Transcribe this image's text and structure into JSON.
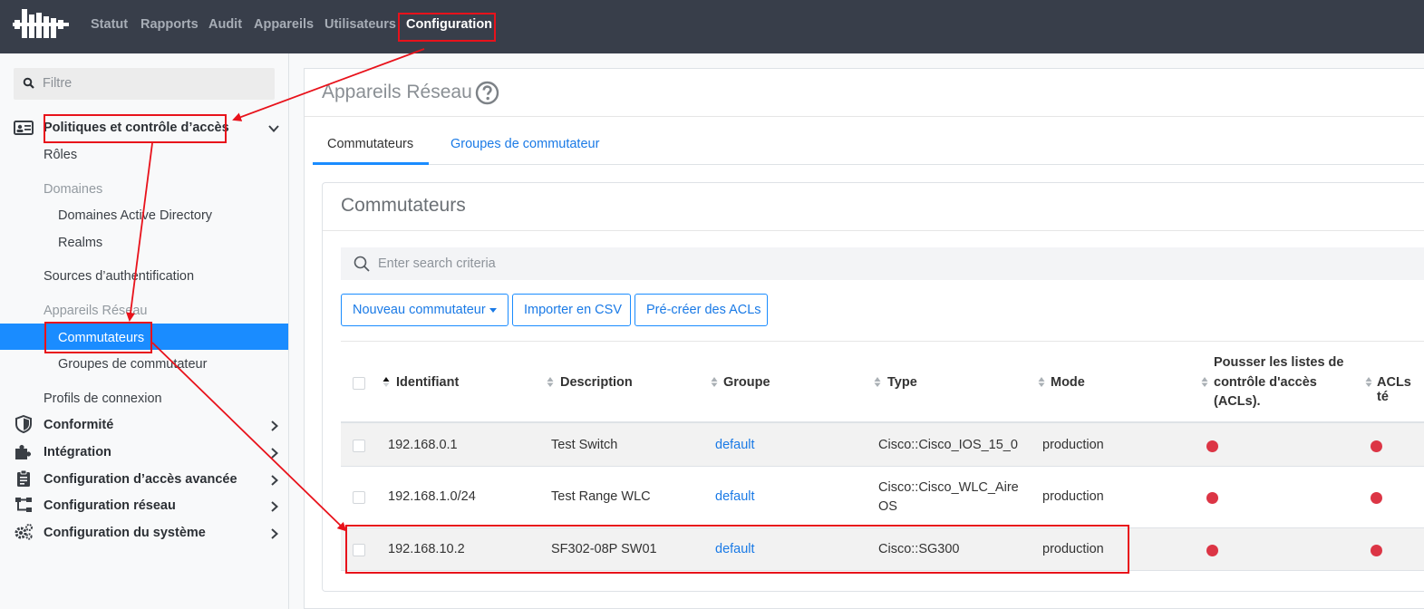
{
  "nav": {
    "items": [
      "Statut",
      "Rapports",
      "Audit",
      "Appareils",
      "Utilisateurs",
      "Configuration"
    ],
    "active": "Configuration"
  },
  "sidebar": {
    "filter_placeholder": "Filtre",
    "sections": {
      "policies": "Politiques et contrôle d’accès",
      "roles": "Rôles",
      "domains": "Domaines",
      "ad_domains": "Domaines Active Directory",
      "realms": "Realms",
      "auth_sources": "Sources d’authentification",
      "network_devices": "Appareils Réseau",
      "switches": "Commutateurs",
      "switch_groups": "Groupes de commutateur",
      "connection_profiles": "Profils de connexion",
      "compliance": "Conformité",
      "integration": "Intégration",
      "advanced_access": "Configuration d’accès avancée",
      "network_config": "Configuration réseau",
      "system_config": "Configuration du système"
    }
  },
  "main": {
    "page_title": "Appareils Réseau",
    "tabs": [
      {
        "label": "Commutateurs",
        "active": true
      },
      {
        "label": "Groupes de commutateur",
        "active": false
      }
    ],
    "card_title": "Commutateurs",
    "search_placeholder": "Enter search criteria",
    "buttons": {
      "new_switch": "Nouveau commutateur",
      "import_csv": "Importer en CSV",
      "precreate_acls": "Pré-créer des ACLs"
    },
    "columns": {
      "id": "Identifiant",
      "description": "Description",
      "group": "Groupe",
      "type": "Type",
      "mode": "Mode",
      "push_acls_1": "Pousser les listes de",
      "push_acls_2": "contrôle d'accès",
      "push_acls_3": "(ACLs).",
      "acls_te": "ACLs té"
    },
    "rows": [
      {
        "id": "192.168.0.1",
        "description": "Test Switch",
        "group": "default",
        "type": "Cisco::Cisco_IOS_15_0",
        "type2": "",
        "mode": "production"
      },
      {
        "id": "192.168.1.0/24",
        "description": "Test Range WLC",
        "group": "default",
        "type": "Cisco::Cisco_WLC_Aire",
        "type2": "OS",
        "mode": "production"
      },
      {
        "id": "192.168.10.2",
        "description": "SF302-08P SW01",
        "group": "default",
        "type": "Cisco::SG300",
        "type2": "",
        "mode": "production"
      }
    ]
  },
  "colors": {
    "topbar": "#383e4a",
    "accent": "#1a8cff",
    "status_red": "#dc3545",
    "annotation": "#e8121b"
  },
  "icons": [
    "logo-icon",
    "search-icon",
    "id-card-icon",
    "chevron-down-icon",
    "chevron-right-icon",
    "shield-icon",
    "puzzle-icon",
    "clipboard-icon",
    "network-icon",
    "gears-icon",
    "help-icon",
    "sort-icon"
  ]
}
